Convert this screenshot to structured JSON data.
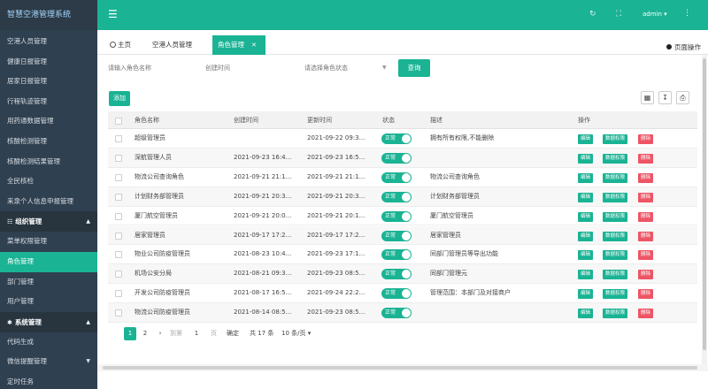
{
  "app": {
    "title": "智慧空港管理系统"
  },
  "sidebar": {
    "items": [
      {
        "label": "空港人员管理"
      },
      {
        "label": "健康日报管理"
      },
      {
        "label": "居家日报管理"
      },
      {
        "label": "行程轨迹管理"
      },
      {
        "label": "用药通数据管理"
      },
      {
        "label": "核酸检测管理"
      },
      {
        "label": "核酸检测结果管理"
      },
      {
        "label": "全民核检"
      },
      {
        "label": "来泉个人信息申报管理"
      }
    ],
    "group_org": {
      "label": "组织管理",
      "icon": "group-icon"
    },
    "org_items": [
      {
        "label": "菜单权限管理"
      },
      {
        "label": "角色管理"
      },
      {
        "label": "部门管理"
      },
      {
        "label": "用户管理"
      }
    ],
    "group_sys": {
      "label": "系统管理",
      "icon": "gear-icon"
    },
    "sys_items": [
      {
        "label": "代码生成"
      },
      {
        "label": "微信提醒管理"
      },
      {
        "label": "定时任务"
      }
    ]
  },
  "topbar": {
    "user": "admin"
  },
  "tabs": [
    {
      "label": "主页"
    },
    {
      "label": "空港人员管理"
    },
    {
      "label": "角色管理"
    }
  ],
  "page_op": "页面操作",
  "filters": {
    "role_name_placeholder": "请输入角色名称",
    "created_placeholder": "创建时间",
    "status_placeholder": "请选择角色状态",
    "search_label": "查询"
  },
  "toolbar": {
    "add_label": "添加"
  },
  "table": {
    "headers": {
      "name": "角色名称",
      "created": "创建时间",
      "updated": "更新时间",
      "status": "状态",
      "desc": "描述",
      "ops": "操作"
    },
    "status_on": "正常",
    "actions": {
      "edit": "编辑",
      "perm": "数据权限",
      "del": "删除"
    },
    "rows": [
      {
        "name": "超级管理员",
        "created": "",
        "updated": "2021-09-22 09:3...",
        "desc": "拥有所有权限,不能删除"
      },
      {
        "name": "深航管理人员",
        "created": "2021-09-23 16:4...",
        "updated": "2021-09-23 16:5...",
        "desc": ""
      },
      {
        "name": "物流公司查询角色",
        "created": "2021-09-21 21:1...",
        "updated": "2021-09-21 21:1...",
        "desc": "物流公司查询角色"
      },
      {
        "name": "计划财务部管理员",
        "created": "2021-09-21 20:3...",
        "updated": "2021-09-21 20:3...",
        "desc": "计划财务部管理员"
      },
      {
        "name": "厦门航空管理员",
        "created": "2021-09-21 20:0...",
        "updated": "2021-09-21 20:1...",
        "desc": "厦门航空管理员"
      },
      {
        "name": "居家管理员",
        "created": "2021-09-17 17:2...",
        "updated": "2021-09-17 17:2...",
        "desc": "居家管理员"
      },
      {
        "name": "物业公司防疫管理员",
        "created": "2021-08-23 10:4...",
        "updated": "2021-09-23 17:1...",
        "desc": "同部门管理员等导出功能"
      },
      {
        "name": "机场公安分局",
        "created": "2021-08-21 09:3...",
        "updated": "2021-09-23 08:5...",
        "desc": "同部门管理元"
      },
      {
        "name": "开发公司防疫管理员",
        "created": "2021-08-17 16:5...",
        "updated": "2021-09-24 22:2...",
        "desc": "管理范围：本部门及对接商户"
      },
      {
        "name": "物流公司防疫管理员",
        "created": "2021-08-14 08:5...",
        "updated": "2021-09-23 08:5...",
        "desc": ""
      }
    ]
  },
  "pager": {
    "page1": "1",
    "page2": "2",
    "goto_label": "到第",
    "goto_value": "1",
    "page_unit": "页",
    "confirm": "确定",
    "total": "共 17 条",
    "page_size": "10 条/页"
  }
}
